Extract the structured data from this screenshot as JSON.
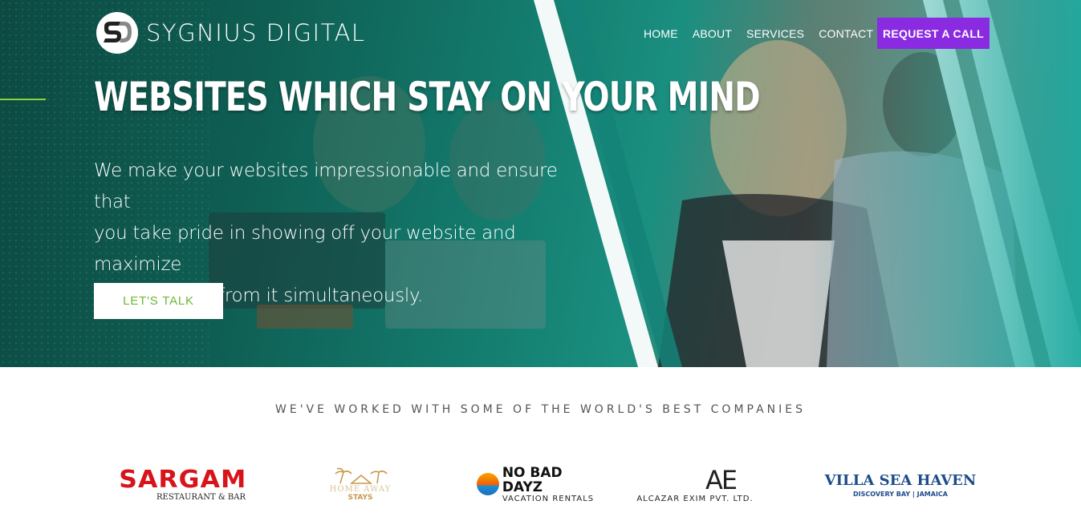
{
  "brand": {
    "name": "SYGNIUS DIGITAL",
    "logo_icon": "sd-monogram-icon"
  },
  "nav": {
    "items": [
      "HOME",
      "ABOUT",
      "SERVICES",
      "CONTACT"
    ],
    "cta": "REQUEST A CALL",
    "cta_color": "#8a2be2"
  },
  "hero": {
    "headline": "WEBSITES WHICH STAY ON YOUR MIND",
    "subtext_lines": [
      "We make your websites impressionable and ensure that",
      "you take pride in showing off your website and maximize",
      "your benefits from it simultaneously."
    ],
    "button": "LET'S TALK",
    "accent_color": "#8ed23a"
  },
  "clients": {
    "title": "WE'VE WORKED WITH SOME OF THE WORLD'S BEST COMPANIES",
    "logos": [
      {
        "name": "SARGAM",
        "sub": "RESTAURANT & BAR"
      },
      {
        "name": "HOME AWAY",
        "sub": "STAYS"
      },
      {
        "name": "NO BAD DAYZ",
        "sub": "VACATION RENTALS"
      },
      {
        "name": "AE",
        "sub": "ALCAZAR EXIM PVT. LTD."
      },
      {
        "name": "VILLA SEA HAVEN",
        "sub": "DISCOVERY BAY | JAMAICA"
      }
    ]
  }
}
